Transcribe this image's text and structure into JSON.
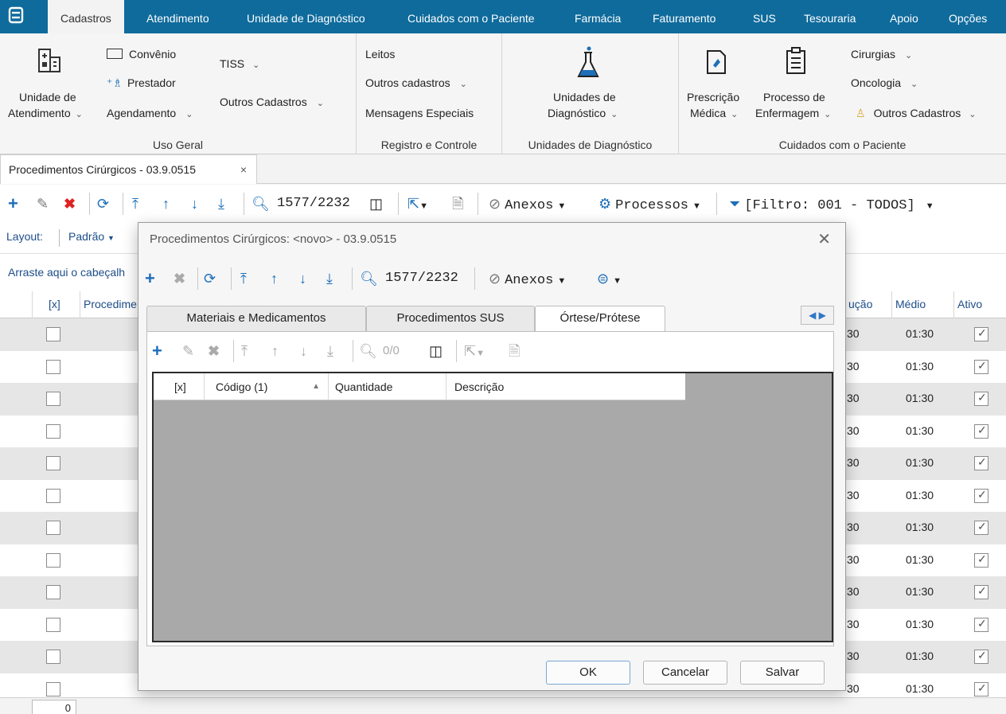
{
  "menubar": {
    "items": [
      "Cadastros",
      "Atendimento",
      "Unidade de Diagnóstico",
      "Cuidados com o Paciente",
      "Farmácia",
      "Faturamento",
      "SUS",
      "Tesouraria",
      "Apoio",
      "Opções"
    ]
  },
  "ribbon": {
    "uso_geral": {
      "title": "Uso Geral",
      "unidade_line1": "Unidade de",
      "unidade_line2": "Atendimento",
      "convenio": "Convênio",
      "prestador": "Prestador",
      "agendamento": "Agendamento",
      "tiss": "TISS",
      "outros_cadastros": "Outros Cadastros"
    },
    "registro": {
      "title": "Registro e Controle",
      "leitos": "Leitos",
      "outros_cadastros": "Outros cadastros",
      "mensagens": "Mensagens Especiais"
    },
    "unidades_diag": {
      "title": "Unidades de Diagnóstico",
      "line1": "Unidades de",
      "line2": "Diagnóstico"
    },
    "cuidados": {
      "title": "Cuidados com o Paciente",
      "prescricao_line1": "Prescrição",
      "prescricao_line2": "Médica",
      "processo_line1": "Processo de",
      "processo_line2": "Enfermagem",
      "cirurgias": "Cirurgias",
      "oncologia": "Oncologia",
      "outros_cadastros": "Outros Cadastros"
    }
  },
  "doc_tab": {
    "label": "Procedimentos Cirúrgicos - 03.9.0515",
    "close": "×"
  },
  "main_toolbar": {
    "record_counter": "1577/2232",
    "anexos": "Anexos",
    "processos": "Processos",
    "filtro": "[Filtro: 001 - TODOS]"
  },
  "layout_row": {
    "layout_label": "Layout:",
    "padrao": "Padrão"
  },
  "groupby_row": {
    "text": "Arraste aqui o cabeçalh"
  },
  "grid": {
    "headers": {
      "x": "[x]",
      "procedimento": "Procedime",
      "execucao": "ução",
      "medio": "Médio",
      "ativo": "Ativo"
    },
    "rows": [
      {
        "exec": "30",
        "medio": "01:30"
      },
      {
        "exec": "30",
        "medio": "01:30"
      },
      {
        "exec": "30",
        "medio": "01:30"
      },
      {
        "exec": "30",
        "medio": "01:30"
      },
      {
        "exec": "30",
        "medio": "01:30"
      },
      {
        "exec": "30",
        "medio": "01:30"
      },
      {
        "exec": "30",
        "medio": "01:30"
      },
      {
        "exec": "30",
        "medio": "01:30"
      },
      {
        "exec": "30",
        "medio": "01:30"
      },
      {
        "exec": "30",
        "medio": "01:30"
      },
      {
        "exec": "30",
        "medio": "01:30"
      },
      {
        "exec": "30",
        "medio": "01:30"
      }
    ]
  },
  "statusbar": {
    "count": "0"
  },
  "dialog": {
    "title": "Procedimentos Cirúrgicos: <novo> - 03.9.0515",
    "record_counter": "1577/2232",
    "anexos": "Anexos",
    "tabs": [
      "Materiais e Medicamentos",
      "Procedimentos SUS",
      "Órtese/Prótese"
    ],
    "active_tab": "Órtese/Prótese",
    "inner_counter": "0/0",
    "inner_headers": {
      "x": "[x]",
      "codigo": "Código (1)",
      "quantidade": "Quantidade",
      "descricao": "Descrição"
    },
    "buttons": {
      "ok": "OK",
      "cancelar": "Cancelar",
      "salvar": "Salvar"
    }
  }
}
